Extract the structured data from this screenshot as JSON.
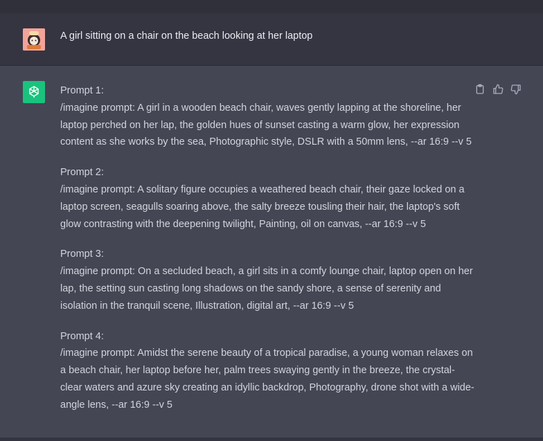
{
  "user_message": {
    "text": "A girl sitting on a chair on the beach looking at her laptop",
    "avatar_icon": "user-avatar-icon"
  },
  "assistant_message": {
    "logo_icon": "openai-logo-icon",
    "prompts": [
      {
        "heading": "Prompt 1:",
        "body": "/imagine prompt: A girl in a wooden beach chair, waves gently lapping at the shoreline, her laptop perched on her lap, the golden hues of sunset casting a warm glow, her expression content as she works by the sea, Photographic style, DSLR with a 50mm lens, --ar 16:9 --v 5"
      },
      {
        "heading": "Prompt 2:",
        "body": "/imagine prompt: A solitary figure occupies a weathered beach chair, their gaze locked on a laptop screen, seagulls soaring above, the salty breeze tousling their hair, the laptop's soft glow contrasting with the deepening twilight, Painting, oil on canvas, --ar 16:9 --v 5"
      },
      {
        "heading": "Prompt 3:",
        "body": "/imagine prompt: On a secluded beach, a girl sits in a comfy lounge chair, laptop open on her lap, the setting sun casting long shadows on the sandy shore, a sense of serenity and isolation in the tranquil scene, Illustration, digital art, --ar 16:9 --v 5"
      },
      {
        "heading": "Prompt 4:",
        "body": "/imagine prompt: Amidst the serene beauty of a tropical paradise, a young woman relaxes on a beach chair, her laptop before her, palm trees swaying gently in the breeze, the crystal-clear waters and azure sky creating an idyllic backdrop, Photography, drone shot with a wide-angle lens, --ar 16:9 --v 5"
      }
    ],
    "actions": {
      "copy_icon": "clipboard-icon",
      "thumbs_up_icon": "thumbs-up-icon",
      "thumbs_down_icon": "thumbs-down-icon"
    }
  },
  "colors": {
    "page_background": "#343541",
    "assistant_background": "#444654",
    "logo_green": "#19c37d",
    "text": "#d1d5db"
  }
}
